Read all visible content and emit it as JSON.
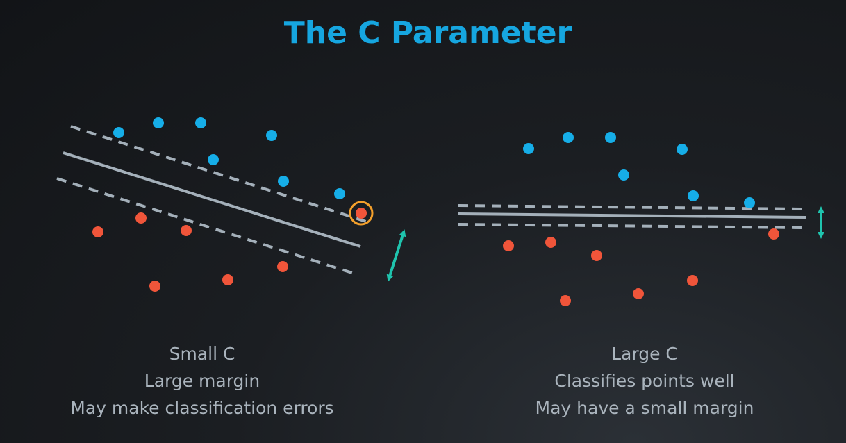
{
  "title": "The C Parameter",
  "colors": {
    "title": "#16a6e0",
    "blue_point": "#16aee8",
    "red_point": "#f0553a",
    "line": "#a4b0ba",
    "arrow": "#1fc4ae",
    "highlight_ring": "#f4a02b",
    "caption_text": "#aab4bd"
  },
  "panels": [
    {
      "id": "left",
      "caption": [
        "Small C",
        "Large margin",
        "May make classification errors"
      ],
      "margin_size": "large",
      "misclassified_highlight": true
    },
    {
      "id": "right",
      "caption": [
        "Large C",
        "Classifies points well",
        "May have a small margin"
      ],
      "margin_size": "small",
      "misclassified_highlight": false
    }
  ],
  "icons": {
    "margin_arrow": "double-headed-arrow-icon",
    "error_marker": "circle-highlight-icon"
  }
}
